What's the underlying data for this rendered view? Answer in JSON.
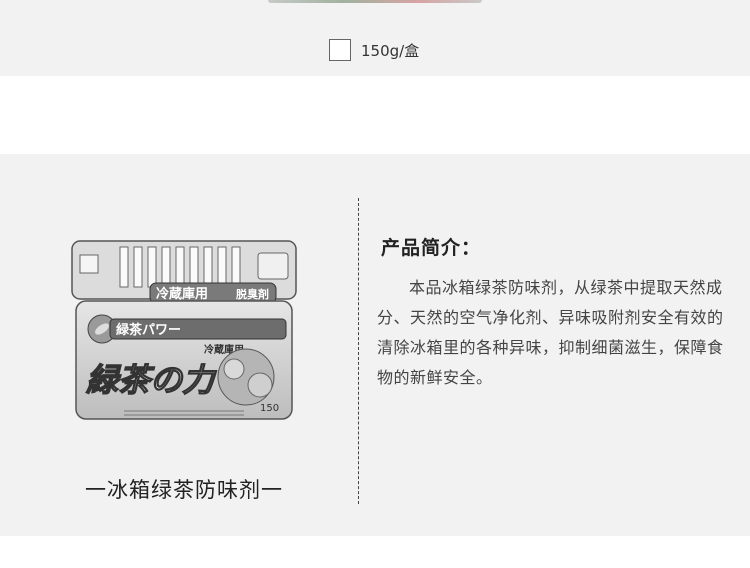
{
  "spec": {
    "label": "150g/盒",
    "checked": false
  },
  "product": {
    "caption": "一冰箱绿茶防味剂一",
    "image_text": {
      "lid": "冷蔵庫用",
      "lid_right": "脱臭剤",
      "banner": "緑茶パワー",
      "sub": "冷蔵庫用",
      "brand": "緑茶の力",
      "weight": "150"
    }
  },
  "intro": {
    "title": "产品简介：",
    "body": "本品冰箱绿茶防味剂，从绿茶中提取天然成分、天然的空气净化剂、异味吸附剂安全有效的清除冰箱里的各种异味，抑制细菌滋生，保障食物的新鲜安全。"
  }
}
